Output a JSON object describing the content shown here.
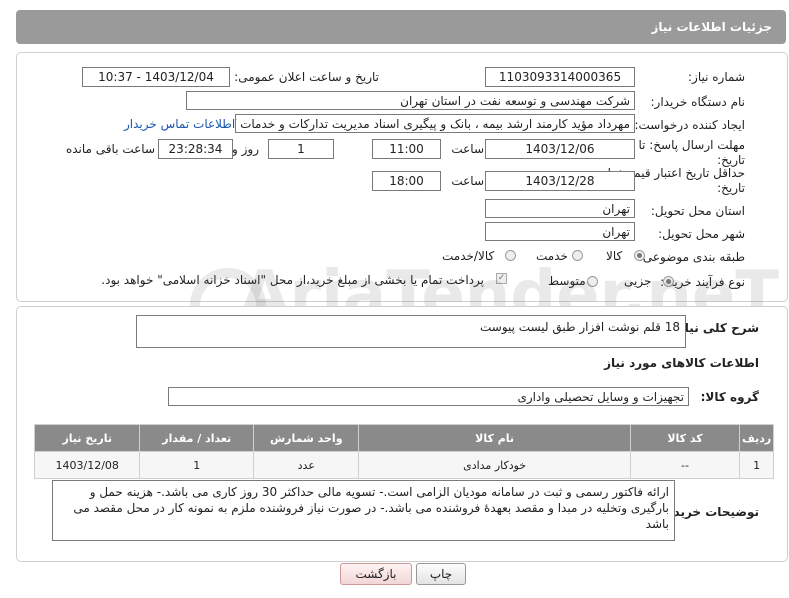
{
  "header": {
    "title": "جزئیات اطلاعات نیاز"
  },
  "form": {
    "need_number_label": "شماره نیاز:",
    "need_number": "1103093314000365",
    "announce_label": "تاریخ و ساعت اعلان عمومی:",
    "announce_value": "1403/12/04 - 10:37",
    "buyer_org_label": "نام دستگاه خریدار:",
    "buyer_org": "شرکت مهندسی و توسعه نفت در استان تهران",
    "creator_label": "ایجاد کننده درخواست:",
    "creator": "مهرداد مؤید کارمند ارشد بیمه ، بانک و پیگیری اسناد مدیریت تدارکات و خدمات ک",
    "contact_link": "اطلاعات تماس خریدار",
    "deadline_label_1": "مهلت ارسال پاسخ: تا",
    "deadline_label_2": "تاریخ:",
    "deadline_date": "1403/12/06",
    "time_label": "ساعت",
    "deadline_time": "11:00",
    "days_value": "1",
    "days_label": "روز و",
    "remaining_time": "23:28:34",
    "remaining_label": "ساعت باقی مانده",
    "validity_label_1": "حداقل تاریخ اعتبار قیمت: تا",
    "validity_label_2": "تاریخ:",
    "validity_date": "1403/12/28",
    "validity_time": "18:00",
    "province_label": "استان محل تحویل:",
    "province": "تهران",
    "city_label": "شهر محل تحویل:",
    "city": "تهران",
    "category_label": "طبقه بندی موضوعی:",
    "category_options": [
      "کالا",
      "خدمت",
      "کالا/خدمت"
    ],
    "process_label": "نوع فرآیند خرید :",
    "process_options": [
      "جزیی",
      "متوسط"
    ],
    "payment_note": "پرداخت تمام یا بخشی از مبلغ خرید،از محل \"اسناد خزانه اسلامی\" خواهد بود."
  },
  "details": {
    "summary_label": "شرح کلی نیاز:",
    "summary": "18 قلم نوشت افزار طبق لیست پیوست",
    "goods_info_title": "اطلاعات کالاهای مورد نیاز",
    "goods_group_label": "گروه کالا:",
    "goods_group": "تجهیزات و وسایل تحصیلی واداری",
    "table": {
      "headers": [
        "ردیف",
        "کد کالا",
        "نام کالا",
        "واحد شمارش",
        "تعداد / مقدار",
        "تاریخ نیاز"
      ],
      "rows": [
        [
          "1",
          "--",
          "خودکار مدادی",
          "عدد",
          "1",
          "1403/12/08"
        ]
      ]
    },
    "buyer_notes_label": "توضیحات خریدار:",
    "buyer_notes": "ارائه فاکتور رسمی و ثبت در سامانه مودیان الزامی است.- تسویه مالی حداکثر 30 روز کاری می باشد.- هزینه حمل و بارگیری وتخلیه در مبدا و مقصد بعهدۀ فروشنده می باشد.- در صورت نیاز فروشنده ملزم به نمونه کار در محل مقصد می باشد"
  },
  "buttons": {
    "print": "چاپ",
    "back": "بازگشت"
  },
  "watermark": {
    "text": "AriaTender.neT"
  }
}
